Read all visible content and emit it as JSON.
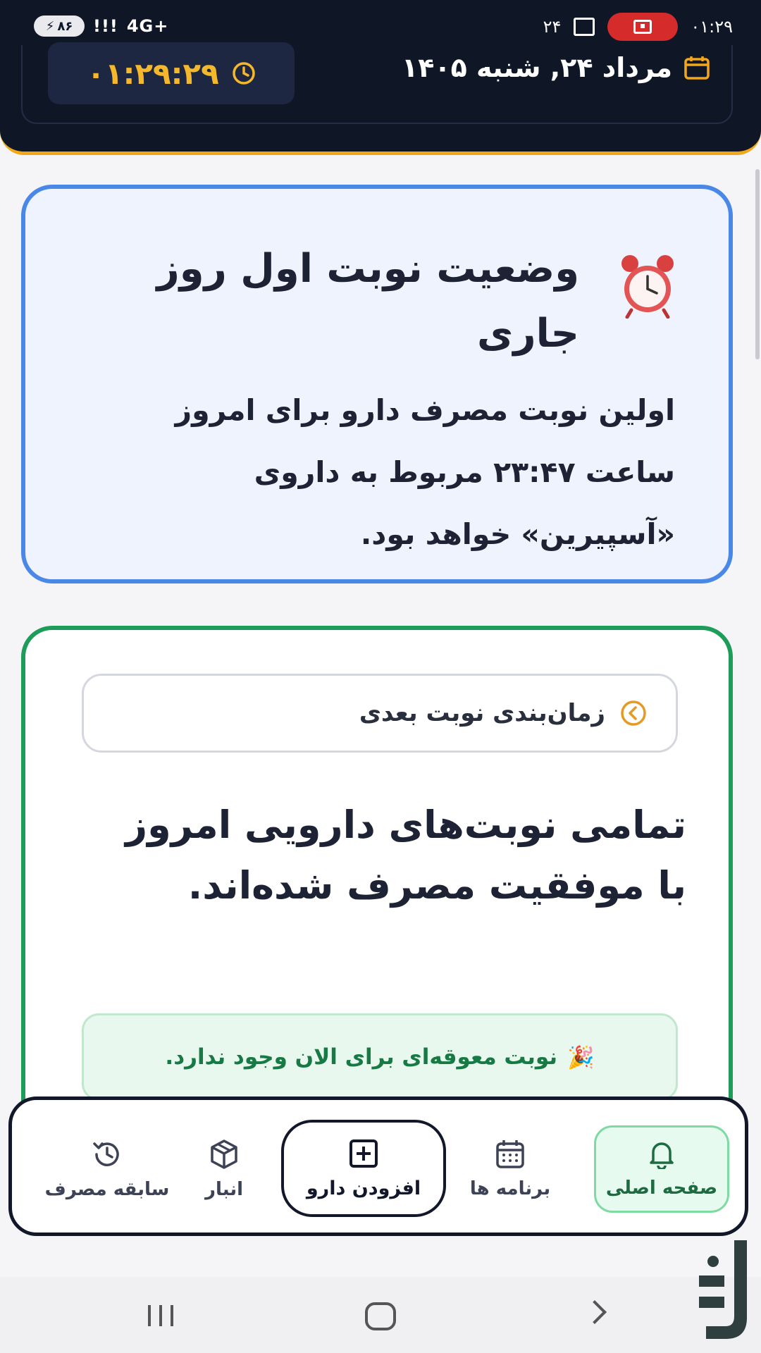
{
  "status_bar": {
    "battery": "۸۶",
    "network": "4G+",
    "time": "۰۱:۲۹",
    "notification_count": "۲۴"
  },
  "header": {
    "date": "مرداد ۲۴, شنبه ۱۴۰۵",
    "clock": "۰۱:۲۹:۲۹"
  },
  "status_card": {
    "title": "وضعیت نوبت اول روز جاری",
    "body": "اولین نوبت مصرف دارو برای امروز ساعت ۲۳:۴۷ مربوط به داروی «آسپیرین» خواهد بود."
  },
  "schedule_card": {
    "header_label": "زمان‌بندی نوبت بعدی",
    "done_message": "تمامی نوبت‌های دارویی امروز با موفقیت مصرف شده‌اند.",
    "no_overdue": "نوبت معوقه‌ای برای الان وجود ندارد."
  },
  "bottom_nav": {
    "home": "صفحه اصلی",
    "plans": "برنامه ها",
    "add_drug": "افزودن دارو",
    "store": "انبار",
    "history": "سابقه مصرف"
  },
  "colors": {
    "dark": "#0f1626",
    "accent_orange": "#f2a71b",
    "status_border": "#4a88e8",
    "schedule_border": "#1e9c5a",
    "clock_text": "#f5b82b"
  }
}
